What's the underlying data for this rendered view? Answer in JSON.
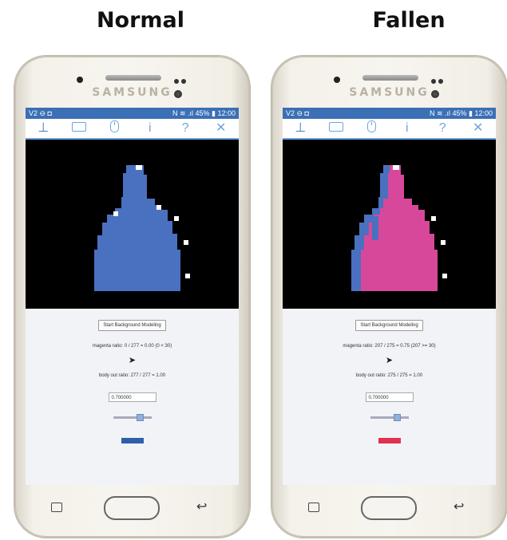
{
  "captions": {
    "left": "Normal",
    "right": "Fallen"
  },
  "phone_brand": "SAMSUNG",
  "statusbar": {
    "left_icons": "V2 ⊖ ◘",
    "right_icons": "N ≋ .ıl 45% ▮ 12:00"
  },
  "phones": [
    {
      "id": "normal",
      "button_label": "Start Background Modeling",
      "magenta_ratio": "magenta ratio: 0 / 277 = 0.00 (0 < 30)",
      "body_out_ratio": "body out ratio: 277 / 277 = 1.00",
      "threshold_value": "0.700000",
      "indicator_color": "#2f5fa8",
      "slider_value": 0.6
    },
    {
      "id": "fallen",
      "button_label": "Start Background Modeling",
      "magenta_ratio": "magenta ratio: 207 / 275 = 0.75 (207 >= 30)",
      "body_out_ratio": "body out ratio: 275 / 275 = 1.00",
      "threshold_value": "0.700000",
      "indicator_color": "#e2304f",
      "slider_value": 0.6
    }
  ],
  "colors": {
    "silhouette_blue": "#4a70c0",
    "silhouette_magenta": "#d8489a",
    "accent": "#6ea5dd"
  }
}
